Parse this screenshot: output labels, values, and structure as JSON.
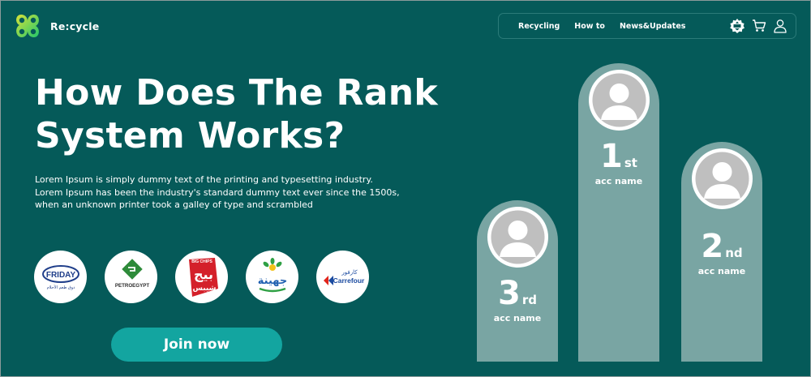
{
  "app": {
    "name": "Re:cycle"
  },
  "nav": {
    "links": [
      "Recycling",
      "How to",
      "News&Updates"
    ],
    "icons": [
      "recycle-badge-icon",
      "cart-icon",
      "user-icon"
    ]
  },
  "hero": {
    "title_line1": "How Does The Rank",
    "title_line2": "System Works?",
    "description": "Lorem Ipsum is simply dummy text of the printing and typesetting industry. Lorem Ipsum has been the industry's standard dummy text ever since the 1500s, when an unknown printer took a galley of type and scrambled"
  },
  "brands": {
    "friday": {
      "text": "FRIDAY",
      "subtext": "دوق طعم الأحلام"
    },
    "petroegypt": {
      "text": "PETROEGYPT"
    },
    "bigchips": {
      "text": "بيج",
      "top": "BIG CHIPS",
      "sub": "شيبس"
    },
    "juhayna": {
      "text": "جهينة"
    },
    "carrefour": {
      "text": "Carrefour",
      "arabic": "كارفور"
    }
  },
  "cta": {
    "join_label": "Join now"
  },
  "podium": {
    "first": {
      "num": "1",
      "suffix": "st",
      "name": "acc name"
    },
    "second": {
      "num": "2",
      "suffix": "nd",
      "name": "acc name"
    },
    "third": {
      "num": "3",
      "suffix": "rd",
      "name": "acc name"
    }
  },
  "colors": {
    "background": "#055a59",
    "pillar": "#79a5a3",
    "button": "#13a5a0",
    "logo_green": "#3bd46a",
    "logo_yellow": "#d7e23a"
  }
}
